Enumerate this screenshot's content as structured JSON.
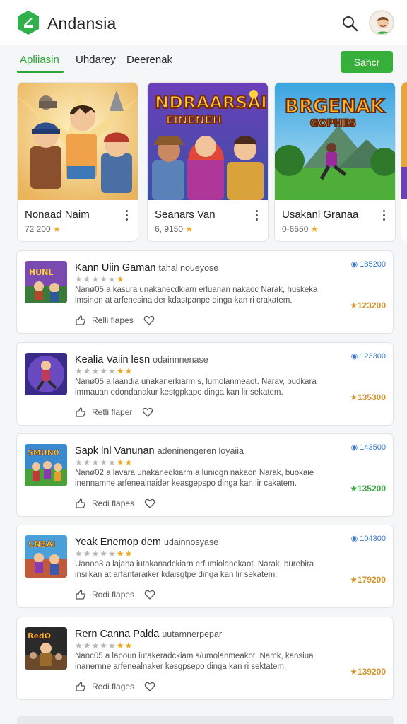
{
  "app": {
    "title": "Andansia",
    "accent": "#36b03a"
  },
  "header": {
    "search_icon": "search-icon",
    "avatar": "user-avatar"
  },
  "tabs": [
    {
      "label": "Apliiasin",
      "active": true
    },
    {
      "label": "Uhdarey",
      "active": false
    },
    {
      "label": "Deerenak",
      "active": false
    }
  ],
  "primary_button": {
    "label": "Sahcr"
  },
  "featured": [
    {
      "title": "Nonaad Naim",
      "meta": "72 200"
    },
    {
      "title": "Seanars Van",
      "meta": "6, 9150"
    },
    {
      "title": "Usakanl Granaa",
      "meta": "0-6550"
    }
  ],
  "list": [
    {
      "name": "Kann Uiin Gaman",
      "sub": "tahal noueyose",
      "desc": "Nanø05 a kasura unakanecdkiam erluarian nakaoc Narak, huskeka imsinon at arfenesinaider kdastpanpe dinga kan ri crakatem.",
      "action": "Relli flapes",
      "right1": "185200",
      "right2": "★123200",
      "right2_color": "orange",
      "stars": {
        "gray": "★★★★★",
        "yellow": "★"
      }
    },
    {
      "name": "Kealia Vaiin lesn",
      "sub": "odainnnenase",
      "desc": "Nanø05 a laandia unakanerkiarm s, lumolanmeaot. Narav, budkara immauan edondanakur kestgpkapo dinga kan lir sekatem.",
      "action": "Retli flaper",
      "right1": "123300",
      "right2": "★135300",
      "right2_color": "orange",
      "stars": {
        "gray": "★★★★★",
        "yellow": "★★"
      }
    },
    {
      "name": "Sapk lnl Vanunan",
      "sub": "adeninengeren loyaiia",
      "desc": "Nanø02 a lavara unakanedkiarm a lunidgn nakaon Narak, buokaie inennamne arfenealnaider keasgepspo dinga kan lir cakatem.",
      "action": "Redi flapes",
      "right1": "143500",
      "right2": "★135200",
      "right2_color": "green",
      "stars": {
        "gray": "★★★★★",
        "yellow": "★★"
      }
    },
    {
      "name": "Yeak Enemop dem",
      "sub": "udainnosyase",
      "desc": "Uanoo3 a lajana iutakanadckiarn erfumiolanekaot. Narak, burebira insiikan at arfantaraiker kdaisgtpe dinga kan lir sekatem.",
      "action": "Rodi flapes",
      "right1": "104300",
      "right2": "★179200",
      "right2_color": "orange",
      "stars": {
        "gray": "★★★★★",
        "yellow": "★★"
      }
    },
    {
      "name": "Rern Canna Palda",
      "sub": "uutamnerpepar",
      "desc": "Nanc05 a lapoun iutakeradckiam s/umolanmeakot. Namk, kansiua inanernne arfenealnaker kesgpsepo dinga kan ri sektatem.",
      "action": "Redi flages",
      "right1": "",
      "right2": "★139200",
      "right2_color": "orange",
      "stars": {
        "gray": "★★★★★",
        "yellow": "★★"
      }
    }
  ]
}
